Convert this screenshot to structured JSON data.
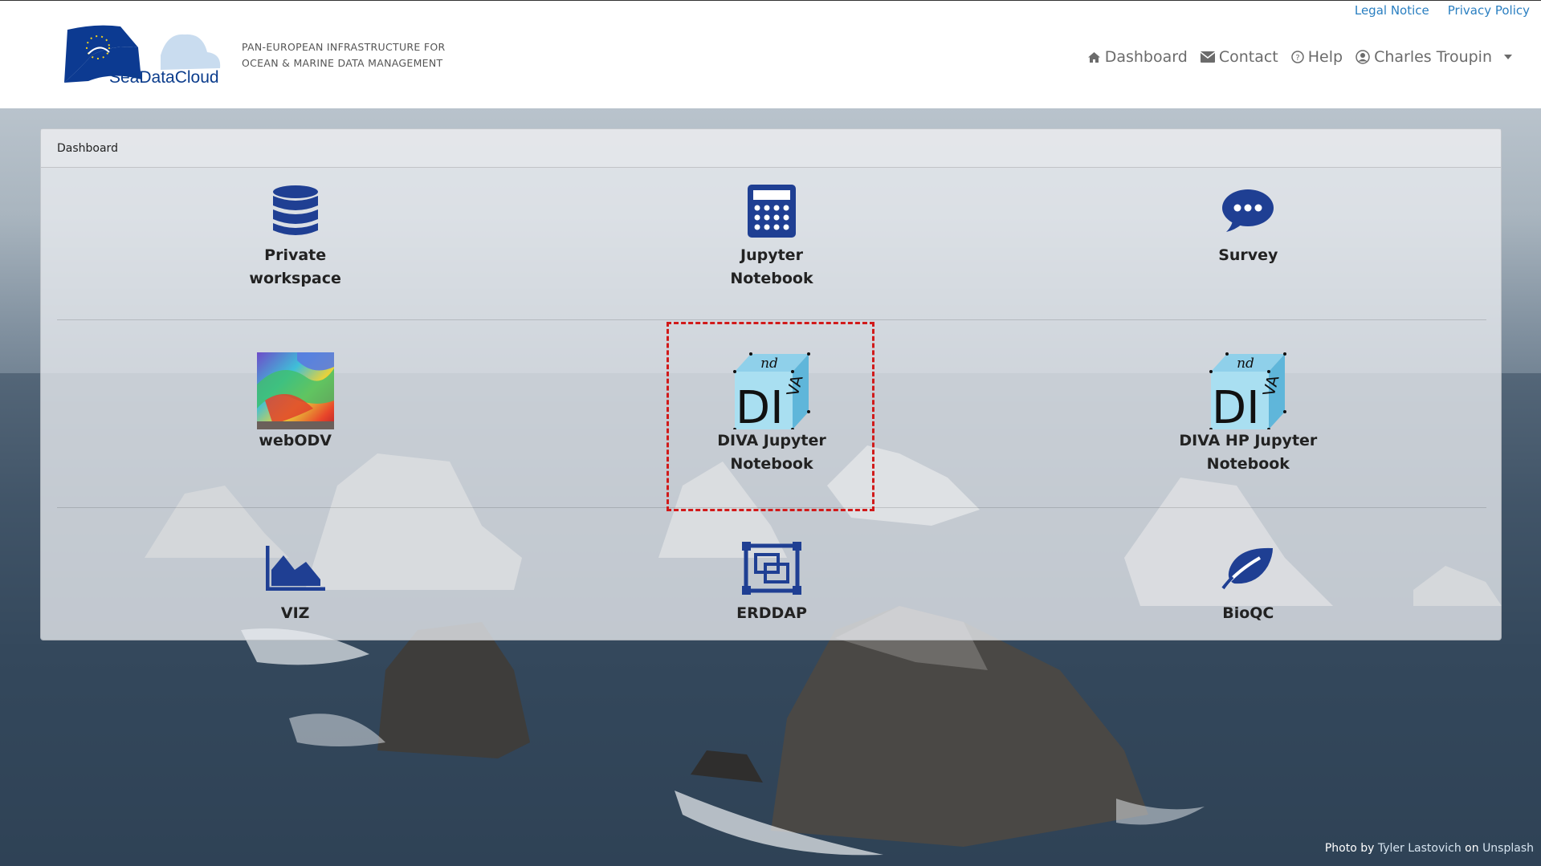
{
  "header": {
    "logo_text": "SeaDataCloud",
    "tagline_line1": "PAN-EUROPEAN INFRASTRUCTURE FOR",
    "tagline_line2": "OCEAN & MARINE DATA MANAGEMENT",
    "top_links": {
      "legal": "Legal Notice",
      "privacy": "Privacy Policy"
    },
    "nav": {
      "dashboard": "Dashboard",
      "contact": "Contact",
      "help": "Help",
      "user": "Charles Troupin"
    }
  },
  "card": {
    "title": "Dashboard",
    "tiles": [
      {
        "label": "Private workspace",
        "icon": "database-icon"
      },
      {
        "label": "Jupyter Notebook",
        "icon": "calculator-icon"
      },
      {
        "label": "Survey",
        "icon": "comment-dots-icon"
      },
      {
        "label": "webODV",
        "icon": "webodv-thumbnail"
      },
      {
        "label": "DIVA Jupyter Notebook",
        "icon": "diva-cube-icon"
      },
      {
        "label": "DIVA HP Jupyter Notebook",
        "icon": "diva-cube-icon"
      },
      {
        "label": "VIZ",
        "icon": "area-chart-icon"
      },
      {
        "label": "ERDDAP",
        "icon": "erddap-icon"
      },
      {
        "label": "BioQC",
        "icon": "leaf-icon"
      }
    ]
  },
  "highlighted_tile": "DIVA Jupyter Notebook",
  "colors": {
    "icon_blue": "#1f3f93",
    "link_blue": "#2a7fc1",
    "highlight_red": "#d11a1a"
  },
  "footer": {
    "credit_prefix": "Photo by",
    "photographer": "Tyler Lastovich",
    "credit_on": "on",
    "site": "Unsplash"
  }
}
